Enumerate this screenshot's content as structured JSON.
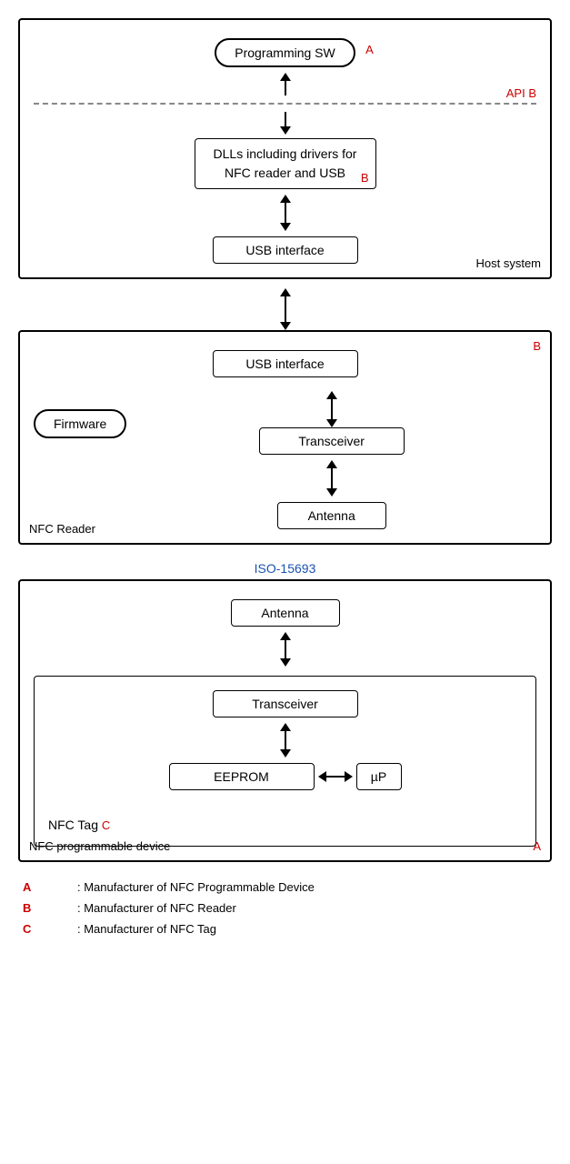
{
  "host_system": {
    "label": "Host system",
    "programming_sw": "Programming SW",
    "programming_sw_badge": "A",
    "api_label": "API",
    "api_badge": "B",
    "dlls_text": "DLLs including drivers for\nNFC reader and USB",
    "dlls_badge": "B",
    "usb_interface": "USB interface"
  },
  "nfc_reader": {
    "label": "NFC Reader",
    "badge": "B",
    "usb_interface": "USB interface",
    "firmware": "Firmware",
    "transceiver": "Transceiver",
    "antenna": "Antenna"
  },
  "iso_label": "ISO-15693",
  "nfc_prog_device": {
    "label": "NFC programmable device",
    "badge": "A",
    "nfc_tag": {
      "label": "NFC Tag",
      "badge": "C",
      "antenna": "Antenna",
      "transceiver": "Transceiver",
      "eeprom": "EEPROM",
      "up": "µP"
    }
  },
  "legend": [
    {
      "key": "A",
      "value": ": Manufacturer of NFC Programmable Device"
    },
    {
      "key": "B",
      "value": ": Manufacturer of NFC Reader"
    },
    {
      "key": "C",
      "value": ": Manufacturer of NFC Tag"
    }
  ]
}
